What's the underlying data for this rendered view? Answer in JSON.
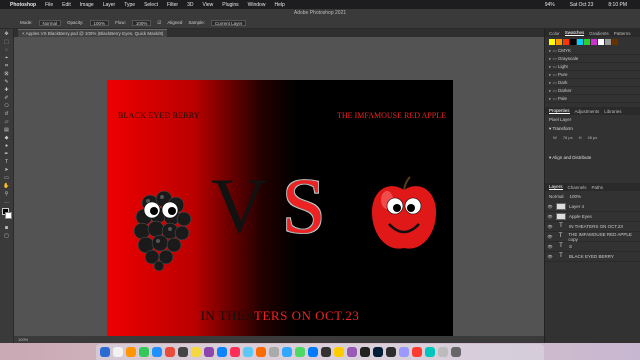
{
  "menubar": {
    "app": "Photoshop",
    "items": [
      "File",
      "Edit",
      "Image",
      "Layer",
      "Type",
      "Select",
      "Filter",
      "3D",
      "View",
      "Plugins",
      "Window",
      "Help"
    ],
    "right": [
      "94%",
      "Sat Oct 23",
      "8:10 PM"
    ]
  },
  "window_title": "Adobe Photoshop 2021",
  "options": {
    "mode_label": "Mode:",
    "mode_value": "Normal",
    "opacity_label": "Opacity:",
    "opacity_value": "100%",
    "flow_label": "Flow:",
    "flow_value": "100%",
    "aligned_label": "Aligned",
    "sample_label": "Sample:",
    "sample_value": "Current Layer"
  },
  "doc_tab": "Apples VS BlackBerry.psd @ 100% (BlackBerry Eyes, Quick Mask/8)",
  "artwork": {
    "top_left_text": "BLACK EYED BERRY",
    "top_right_text": "THE IMFAMOUSE RED APPLE",
    "vs_v": "V",
    "vs_s": "S",
    "bottom_dark": "IN THEA",
    "bottom_red": "TERS ON OCT.23"
  },
  "status": "100%",
  "swatches_panel": {
    "tabs": [
      "Color",
      "Swatches",
      "Gradients",
      "Patterns"
    ],
    "active_tab": "Swatches",
    "colors": [
      "#ffff00",
      "#ff9900",
      "#ff3300",
      "#000000",
      "#00ccff",
      "#33cc33",
      "#cc33cc",
      "#ffffff",
      "#999999",
      "#663300"
    ],
    "folders": [
      "CMYK",
      "Grayscale",
      "Light",
      "Pure",
      "Dark",
      "Darker",
      "Pale"
    ]
  },
  "properties_panel": {
    "tabs": [
      "Properties",
      "Adjustments",
      "Libraries"
    ],
    "layer_type": "Pixel Layer",
    "transform_label": "Transform",
    "w_value": "76 px",
    "h_value": "45 px",
    "align_label": "Align and Distribute"
  },
  "layers_panel": {
    "tabs": [
      "Layers",
      "Channels",
      "Paths"
    ],
    "blend": "Normal",
    "opacity": "100%",
    "layers": [
      {
        "name": "Layer 4",
        "type": "pixel"
      },
      {
        "name": "Apple Eyes",
        "type": "pixel"
      },
      {
        "name": "IN THEATERS ON OCT.23",
        "type": "text"
      },
      {
        "name": "THE IMFAMOUSE RED APPLE copy",
        "type": "text"
      },
      {
        "name": "S",
        "type": "text"
      },
      {
        "name": "BLACK EYED BERRY",
        "type": "text"
      }
    ]
  },
  "dock_colors": [
    "#2b6cd4",
    "#f2f2f2",
    "#ff9500",
    "#34c759",
    "#1e90ff",
    "#e94b3c",
    "#444",
    "#f5d742",
    "#8e44ad",
    "#0a84ff",
    "#ff2d55",
    "#5ac8fa",
    "#ff6b00",
    "#aaa",
    "#31a8ff",
    "#4cd964",
    "#007aff",
    "#333",
    "#ffcc00",
    "#9b59b6",
    "#222",
    "#001e36",
    "#2d2d2d",
    "#9999ff",
    "#ff3b30",
    "#00c7be",
    "#bbb",
    "#666"
  ]
}
